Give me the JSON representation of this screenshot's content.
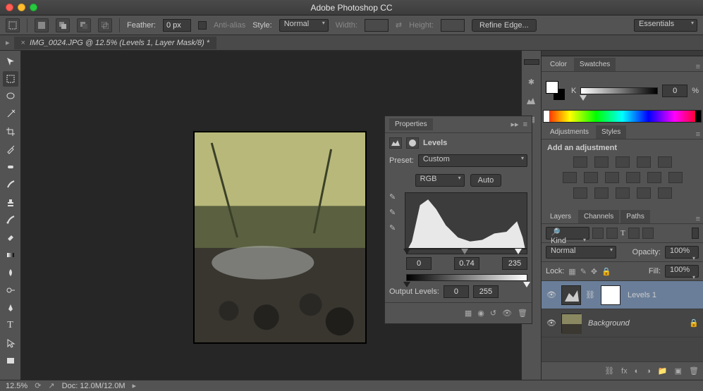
{
  "app": {
    "title": "Adobe Photoshop CC"
  },
  "options": {
    "feather_label": "Feather:",
    "feather_value": "0 px",
    "antialias_label": "Anti-alias",
    "style_label": "Style:",
    "style_value": "Normal",
    "width_label": "Width:",
    "height_label": "Height:",
    "refine_label": "Refine Edge...",
    "workspace": "Essentials"
  },
  "document": {
    "tab": "IMG_0024.JPG @ 12.5% (Levels 1, Layer Mask/8) *"
  },
  "properties": {
    "panel_title": "Properties",
    "type_label": "Levels",
    "preset_label": "Preset:",
    "preset_value": "Custom",
    "channel": "RGB",
    "auto_label": "Auto",
    "input_black": "0",
    "input_gamma": "0.74",
    "input_white": "235",
    "output_label": "Output Levels:",
    "output_black": "0",
    "output_white": "255"
  },
  "color": {
    "tab1": "Color",
    "tab2": "Swatches",
    "channel": "K",
    "value": "0",
    "unit": "%"
  },
  "adjustments": {
    "tab1": "Adjustments",
    "tab2": "Styles",
    "heading": "Add an adjustment"
  },
  "layers": {
    "tab1": "Layers",
    "tab2": "Channels",
    "tab3": "Paths",
    "kind": "Kind",
    "blend_mode": "Normal",
    "opacity_label": "Opacity:",
    "opacity_value": "100%",
    "lock_label": "Lock:",
    "fill_label": "Fill:",
    "fill_value": "100%",
    "items": [
      {
        "name": "Levels 1",
        "selected": true,
        "has_mask": true,
        "adj": true
      },
      {
        "name": "Background",
        "selected": false,
        "locked": true
      }
    ]
  },
  "status": {
    "zoom": "12.5%",
    "doc": "Doc: 12.0M/12.0M"
  }
}
